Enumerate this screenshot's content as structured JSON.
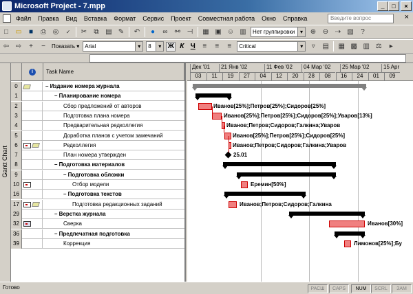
{
  "window": {
    "title": "Microsoft Project - 7.mpp",
    "min": "_",
    "max": "□",
    "close": "×"
  },
  "menu": [
    "Файл",
    "Правка",
    "Вид",
    "Вставка",
    "Формат",
    "Сервис",
    "Проект",
    "Совместная работа",
    "Окно",
    "Справка"
  ],
  "menu_underline": [
    "Ф",
    "П",
    "В",
    "с",
    "м",
    "С",
    "о",
    "",
    "О",
    "С"
  ],
  "help_placeholder": "Введите вопрос",
  "toolbar1": {
    "grouping": "Нет группировки",
    "icons": [
      "new-icon",
      "open-icon",
      "save-icon",
      "print-icon",
      "preview-icon",
      "spell-icon",
      "cut-icon",
      "copy-icon",
      "paste-icon",
      "format-painter-icon",
      "undo-icon",
      "hyperlink-icon",
      "link-icon",
      "unlink-icon",
      "split-icon",
      "info-icon",
      "notes-icon",
      "assign-icon",
      "zoom-in-icon",
      "zoom-out-icon",
      "goto-icon",
      "copy-picture-icon",
      "help-icon"
    ]
  },
  "toolbar2": {
    "show_label": "Показать",
    "font": "Arial",
    "size": "8",
    "bold": "Ж",
    "italic": "К",
    "underline": "Ч",
    "filter": "Critical"
  },
  "sidebar": {
    "label": "Gantt Chart"
  },
  "table": {
    "header": {
      "info": "i",
      "task_name": "Task Name"
    }
  },
  "rows": [
    {
      "id": "0",
      "name": "Издание номера журнала",
      "bold": true,
      "level": 0,
      "collapse": "–",
      "icons": [
        "note"
      ]
    },
    {
      "id": "1",
      "name": "Планирование номера",
      "bold": true,
      "level": 1,
      "collapse": "–",
      "icons": []
    },
    {
      "id": "2",
      "name": "Сбор предложений от авторов",
      "bold": false,
      "level": 2,
      "collapse": "",
      "icons": []
    },
    {
      "id": "3",
      "name": "Подготовка плана номера",
      "bold": false,
      "level": 2,
      "collapse": "",
      "icons": []
    },
    {
      "id": "4",
      "name": "Предварительная редколлегия",
      "bold": false,
      "level": 2,
      "collapse": "",
      "icons": []
    },
    {
      "id": "5",
      "name": "Доработка планов с учетом замечаний",
      "bold": false,
      "level": 2,
      "collapse": "",
      "icons": []
    },
    {
      "id": "6",
      "name": "Редколлегия",
      "bold": false,
      "level": 2,
      "collapse": "",
      "icons": [
        "cal",
        "note"
      ]
    },
    {
      "id": "7",
      "name": "План номера утвержден",
      "bold": false,
      "level": 2,
      "collapse": "",
      "icons": []
    },
    {
      "id": "8",
      "name": "Подготовка материалов",
      "bold": true,
      "level": 1,
      "collapse": "–",
      "icons": []
    },
    {
      "id": "9",
      "name": "Подготовка обложки",
      "bold": true,
      "level": 2,
      "collapse": "–",
      "icons": []
    },
    {
      "id": "10",
      "name": "Отбор модели",
      "bold": false,
      "level": 3,
      "collapse": "",
      "icons": [
        "cal"
      ]
    },
    {
      "id": "16",
      "name": "Подготовка текстов",
      "bold": true,
      "level": 2,
      "collapse": "–",
      "icons": []
    },
    {
      "id": "17",
      "name": "Подготовка редакционных заданий",
      "bold": false,
      "level": 3,
      "collapse": "",
      "icons": [
        "cal",
        "note"
      ]
    },
    {
      "id": "29",
      "name": "Верстка журнала",
      "bold": true,
      "level": 1,
      "collapse": "–",
      "icons": []
    },
    {
      "id": "32",
      "name": "Сверка",
      "bold": false,
      "level": 2,
      "collapse": "",
      "icons": [
        "cal2"
      ]
    },
    {
      "id": "36",
      "name": "Предпечатная подготовка",
      "bold": true,
      "level": 1,
      "collapse": "–",
      "icons": []
    },
    {
      "id": "39",
      "name": "Коррекция",
      "bold": false,
      "level": 2,
      "collapse": "",
      "icons": []
    }
  ],
  "timescale": {
    "months": [
      "Дек '01",
      "21 Янв '02",
      "11 Фев '02",
      "04 Мар '02",
      "25 Мар '02",
      "15 Apr"
    ],
    "weeks": [
      "03",
      "11",
      "19",
      "27",
      "04",
      "12",
      "20",
      "28",
      "08",
      "16",
      "24",
      "01",
      "09"
    ]
  },
  "gantt_labels": {
    "r2": "Иванов[25%];Петров[25%];Сидоров[25%]",
    "r3": "Иванов[25%];Петров[25%];Сидоров[25%];Уваров[13%]",
    "r4": "Иванов;Петров;Сидоров;Галкина;Уваров",
    "r5": "Иванов[25%];Петров[25%];Сидоров[25%]",
    "r6": "Иванов;Петров;Сидоров;Галкина;Уваров",
    "r7": "25.01",
    "r10": "Еремин[50%]",
    "r17": "Иванов;Петров;Сидоров;Галкина",
    "r32": "Иванов[30%]",
    "r39": "Лимонов[25%];Бу"
  },
  "status": {
    "text": "Готово",
    "indicators": [
      "РАСШ",
      "CAPS",
      "NUM",
      "SCRL",
      "ЗАМ"
    ],
    "active": "NUM"
  }
}
